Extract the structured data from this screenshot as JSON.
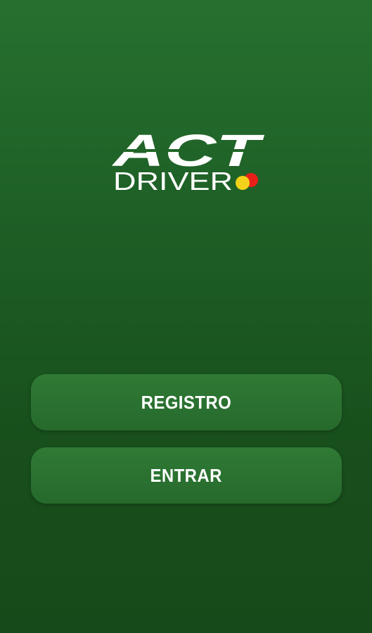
{
  "app": {
    "logo": {
      "top_text": "ACT",
      "bottom_text": "DRIVER"
    }
  },
  "buttons": {
    "registro_label": "REGISTRO",
    "entrar_label": "ENTRAR"
  },
  "colors": {
    "background_top": "#26702f",
    "background_bottom": "#174a1a",
    "button": "#2a7030",
    "text": "#ffffff",
    "logo_dot_red": "#e8201a",
    "logo_dot_yellow": "#f2d21a"
  }
}
